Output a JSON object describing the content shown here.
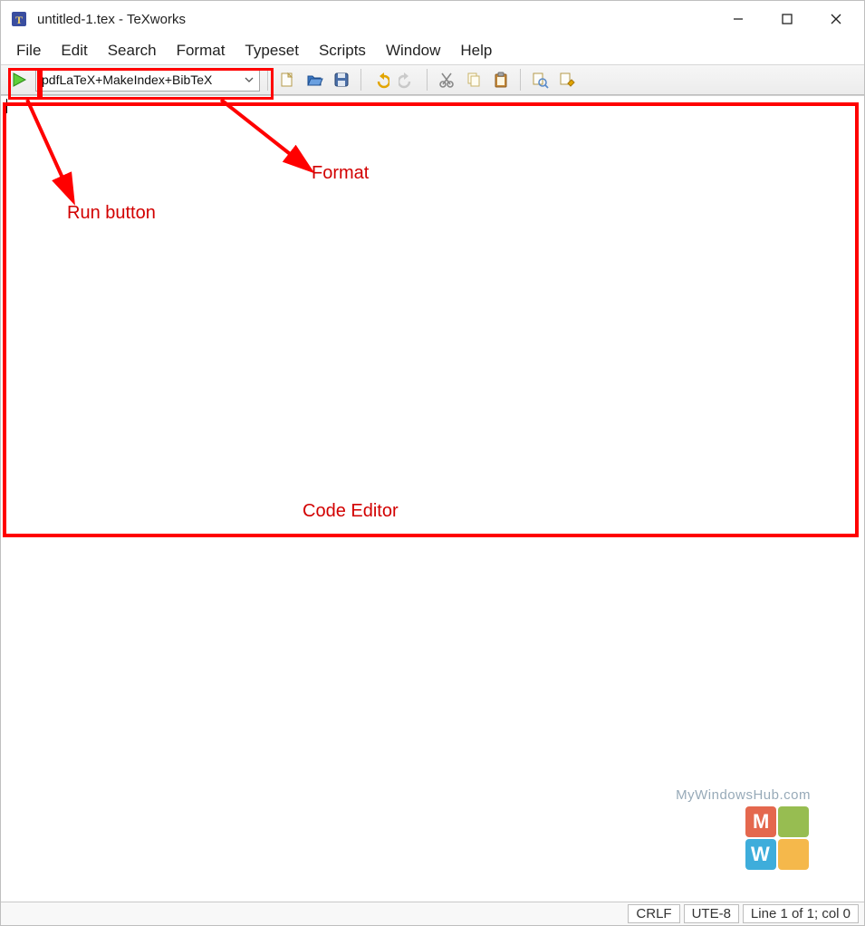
{
  "window": {
    "title": "untitled-1.tex - TeXworks"
  },
  "menu": {
    "file": "File",
    "edit": "Edit",
    "search": "Search",
    "format": "Format",
    "typeset": "Typeset",
    "scripts": "Scripts",
    "window": "Window",
    "help": "Help"
  },
  "toolbar": {
    "engine_selected": "pdfLaTeX+MakeIndex+BibTeX",
    "icons": {
      "run": "play-icon",
      "new": "new-file-icon",
      "open": "open-folder-icon",
      "save": "save-icon",
      "undo": "undo-icon",
      "redo": "redo-icon",
      "cut": "cut-icon",
      "copy": "copy-icon",
      "paste": "paste-icon",
      "find": "find-icon",
      "replace": "replace-icon"
    }
  },
  "status": {
    "line_ending": "CRLF",
    "encoding": "UTE-8",
    "position": "Line 1 of 1; col 0"
  },
  "annotations": {
    "run_button": "Run button",
    "format": "Format",
    "code_editor": "Code Editor"
  },
  "watermark": {
    "text": "MyWindowsHub.com"
  }
}
